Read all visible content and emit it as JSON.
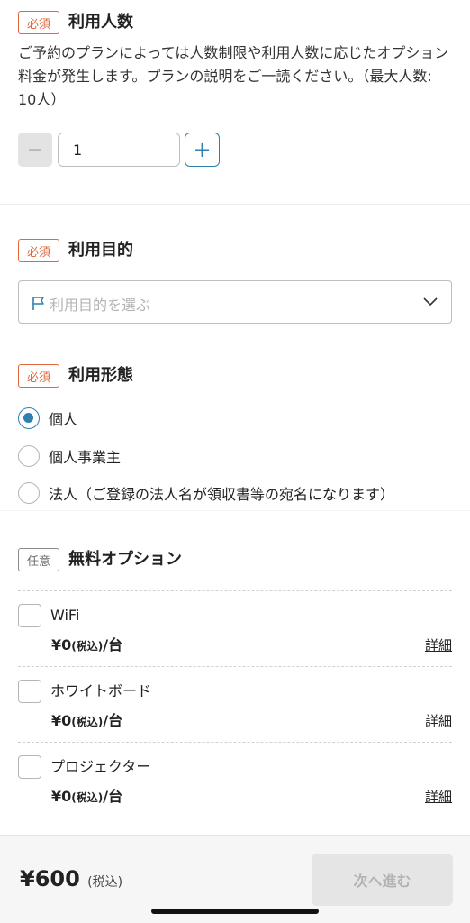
{
  "guests": {
    "tag": "必須",
    "title": "利用人数",
    "description": "ご予約のプランによっては人数制限や利用人数に応じたオプション料金が発生します。プランの説明をご一読ください。（最大人数: 10人）",
    "minus_symbol": "−",
    "value": "1",
    "plus_symbol": "+"
  },
  "purpose": {
    "tag": "必須",
    "title": "利用目的",
    "placeholder": "利用目的を選ぶ"
  },
  "usage_type": {
    "tag": "必須",
    "title": "利用形態",
    "options": [
      {
        "label": "個人",
        "checked": true
      },
      {
        "label": "個人事業主",
        "checked": false
      },
      {
        "label": "法人（ご登録の法人名が領収書等の宛名になります）",
        "checked": false
      }
    ]
  },
  "free_options": {
    "tag": "任意",
    "title": "無料オプション",
    "items": [
      {
        "name": "WiFi",
        "price": "¥0",
        "tax": "(税込)",
        "unit": "/台",
        "detail": "詳細"
      },
      {
        "name": "ホワイトボード",
        "price": "¥0",
        "tax": "(税込)",
        "unit": "/台",
        "detail": "詳細"
      },
      {
        "name": "プロジェクター",
        "price": "¥0",
        "tax": "(税込)",
        "unit": "/台",
        "detail": "詳細"
      }
    ]
  },
  "footer": {
    "total": "¥600",
    "tax": "(税込)",
    "next_label": "次へ進む"
  },
  "colors": {
    "required_accent": "#e2673d",
    "primary_blue": "#2f7fb0",
    "disabled_gray": "#e5e5e5"
  },
  "icons": {
    "flag": "flag-icon",
    "chevron": "chevron-down-icon"
  }
}
